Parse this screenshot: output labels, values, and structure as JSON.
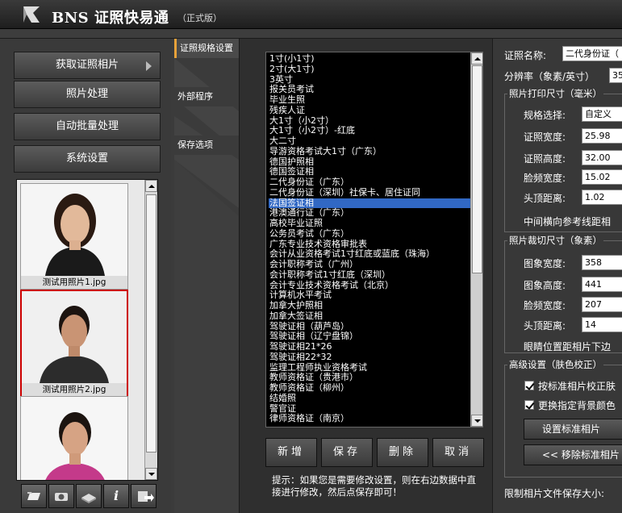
{
  "app": {
    "title": "BNS 证照快易通",
    "edition": "（正式版）"
  },
  "nav": [
    {
      "label": "获取证照相片"
    },
    {
      "label": "照片处理"
    },
    {
      "label": "自动批量处理"
    },
    {
      "label": "系统设置"
    }
  ],
  "photos": [
    {
      "caption": "测试用照片1.jpg"
    },
    {
      "caption": "测试用照片2.jpg"
    },
    {
      "caption": ""
    }
  ],
  "tools": [
    {
      "icon": "folder-icon"
    },
    {
      "icon": "camera-icon"
    },
    {
      "icon": "scanner-icon"
    },
    {
      "icon": "info-icon",
      "glyph": "i"
    },
    {
      "icon": "export-icon"
    }
  ],
  "tabs": [
    {
      "label": "证照规格设置"
    },
    {
      "label": "外部程序"
    },
    {
      "label": "保存选项"
    }
  ],
  "specs": {
    "selected_index": 14,
    "items": [
      "1寸(小1寸)",
      "2寸(大1寸)",
      "3英寸",
      "报关员考试",
      "毕业生照",
      "残疾人证",
      "大1寸（小2寸）",
      "大1寸（小2寸）-红底",
      "大二寸",
      "导游资格考试大1寸（广东）",
      "德国护照相",
      "德国签证相",
      "二代身份证（广东）",
      "二代身份证（深圳）社保卡、居住证同",
      "法国签证相",
      "港澳通行证（广东）",
      "高校毕业证照",
      "公务员考试（广东）",
      "广东专业技术资格审批表",
      "会计从业资格考试1寸红底或蓝底（珠海）",
      "会计职称考试（广州）",
      "会计职称考试1寸红底（深圳）",
      "会计专业技术资格考试（北京）",
      "计算机水平考试",
      "加拿大护照相",
      "加拿大签证相",
      "驾驶证相（葫芦岛）",
      "驾驶证相（辽宁盘锦）",
      "驾驶证相21*26",
      "驾驶证相22*32",
      "监理工程师执业资格考试",
      "教师资格证（贵港市）",
      "教师资格证（柳州）",
      "结婚照",
      "警官证",
      "律师资格证（南京）"
    ]
  },
  "actions": {
    "add": "新增",
    "save": "保存",
    "delete": "删除",
    "cancel": "取消"
  },
  "hint": "提示：如果您是需要修改设置，则在右边数据中直接进行修改，然后点保存即可！",
  "form": {
    "name_label": "证照名称:",
    "name_value": "二代身份证（",
    "dpi_label": "分辨率（象素/英寸）",
    "dpi_value": "35",
    "print_group": "照片打印尺寸（毫米）",
    "spec_select_label": "规格选择:",
    "spec_select_value": "自定义",
    "width_label": "证照宽度:",
    "width_value": "25.98",
    "height_label": "证照高度:",
    "height_value": "32.00",
    "face_width_label": "脸频宽度:",
    "face_width_value": "15.02",
    "head_dist_label": "头顶距离:",
    "head_dist_value": "1.02",
    "midline_label": "中间横向参考线距相",
    "crop_group": "照片裁切尺寸（象素）",
    "img_width_label": "图象宽度:",
    "img_width_value": "358",
    "img_height_label": "图象高度:",
    "img_height_value": "441",
    "crop_face_label": "脸频宽度:",
    "crop_face_value": "207",
    "crop_head_label": "头顶距离:",
    "crop_head_value": "14",
    "eye_label": "眼睛位置距相片下边",
    "adv_group": "高级设置（肤色校正）",
    "chk1_label": "按标准相片校正肤",
    "chk2_label": "更换指定背景颜色",
    "set_std_btn": "设置标准相片",
    "remove_std_btn": "<<  移除标准相片",
    "size_limit_label": "限制相片文件保存大小:"
  },
  "colors": {
    "selection": "#3168c4",
    "accent": "#e8a23a",
    "selected_thumb_border": "#cc0000"
  }
}
